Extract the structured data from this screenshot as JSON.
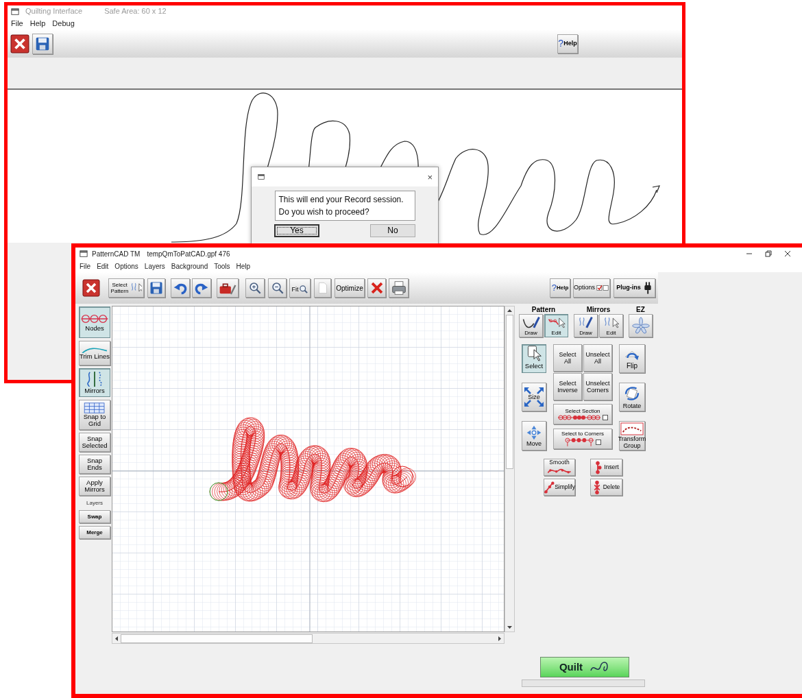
{
  "record_window": {
    "title": "Quilting Interface",
    "safe_area": "Safe Area: 60 x 12",
    "menu": [
      "File",
      "Help",
      "Debug"
    ],
    "help_button": {
      "mark": "?",
      "label": "Help"
    },
    "dialog": {
      "close": "×",
      "message_lines": [
        "This will end your Record session.",
        "Do you wish to proceed?"
      ],
      "buttons": [
        {
          "label": "Yes",
          "selected": true
        },
        {
          "label": "No",
          "selected": false
        }
      ]
    }
  },
  "pattern_window": {
    "title": "PatternCAD TM",
    "file": "tempQmToPatCAD.gpf 476",
    "menu": [
      "File",
      "Edit",
      "Options",
      "Layers",
      "Background",
      "Tools",
      "Help"
    ],
    "toolbar": {
      "select_pattern": "Select Pattern",
      "fit": "Fit",
      "optimize": "Optimize",
      "help": {
        "mark": "?",
        "label": "Help"
      },
      "options": "Options",
      "plugins": "Plug-ins"
    },
    "left_tools": [
      {
        "kind": "nodes",
        "label": "Nodes",
        "selected": true
      },
      {
        "kind": "trim",
        "label": "Trim Lines",
        "selected": false
      },
      {
        "kind": "mirrors",
        "label": "Mirrors",
        "selected": true
      },
      {
        "kind": "grid",
        "label": "Snap to Grid",
        "selected": false
      },
      {
        "kind": "text",
        "label": "Snap Selected",
        "selected": false
      },
      {
        "kind": "text",
        "label": "Snap Ends",
        "selected": false
      },
      {
        "kind": "text",
        "label": "Apply Mirrors",
        "selected": false
      }
    ],
    "layers": {
      "label": "Layers",
      "buttons": [
        "Swap",
        "Merge"
      ]
    },
    "mode_groups": [
      {
        "label": "Pattern",
        "buttons": [
          {
            "kind": "draw",
            "label": "Draw",
            "selected": false
          },
          {
            "kind": "edit",
            "label": "Edit",
            "selected": true
          }
        ]
      },
      {
        "label": "Mirrors",
        "buttons": [
          {
            "kind": "mirror-draw",
            "label": "Draw",
            "selected": false
          },
          {
            "kind": "mirror-edit",
            "label": "Edit",
            "selected": false
          }
        ]
      },
      {
        "label": "EZ",
        "buttons": [
          {
            "kind": "ez",
            "selected": false
          }
        ]
      }
    ],
    "edit_tools": {
      "select": {
        "label": "Select",
        "selected": true
      },
      "size": "Size",
      "move": "Move",
      "select_all": "Select All",
      "unselect_all": "Unselect All",
      "select_inverse": "Select Inverse",
      "unselect_corners": "Unselect Corners",
      "select_section": {
        "label": "Select Section",
        "checked": false
      },
      "select_to_corners": {
        "label": "Select to Corners",
        "checked": false
      },
      "flip": "Flip",
      "rotate": "Rotate",
      "transform_group": "Transform Group",
      "smooth": "Smooth",
      "insert": "Insert",
      "simplify": "Simplify",
      "delete": "Delete"
    },
    "quilt_button": "Quilt",
    "progress": {
      "level": 0
    }
  }
}
